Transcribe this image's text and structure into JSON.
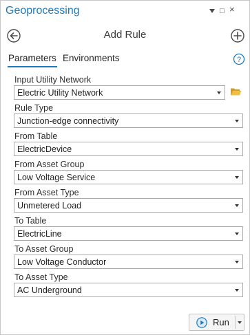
{
  "window": {
    "title": "Geoprocessing",
    "controls": {
      "pin": "pin-icon",
      "dock": "dock-icon",
      "close": "close-icon"
    }
  },
  "header": {
    "title": "Add Rule",
    "back_icon": "back-arrow-icon",
    "add_icon": "add-circle-icon"
  },
  "tabs": [
    {
      "label": "Parameters",
      "active": true
    },
    {
      "label": "Environments",
      "active": false
    }
  ],
  "help_icon": "help-icon",
  "fields": [
    {
      "label": "Input Utility Network",
      "value": "Electric Utility Network",
      "has_browse": true
    },
    {
      "label": "Rule Type",
      "value": "Junction-edge connectivity"
    },
    {
      "label": "From Table",
      "value": "ElectricDevice"
    },
    {
      "label": "From Asset Group",
      "value": "Low Voltage Service"
    },
    {
      "label": "From Asset Type",
      "value": "Unmetered Load"
    },
    {
      "label": "To Table",
      "value": "ElectricLine"
    },
    {
      "label": "To Asset Group",
      "value": "Low Voltage Conductor"
    },
    {
      "label": "To Asset Type",
      "value": "AC Underground"
    }
  ],
  "run_button": {
    "label": "Run",
    "icon": "play-icon"
  },
  "colors": {
    "accent": "#1a7bc4",
    "folder": "#e8b33a",
    "border": "#a8a8a8"
  }
}
